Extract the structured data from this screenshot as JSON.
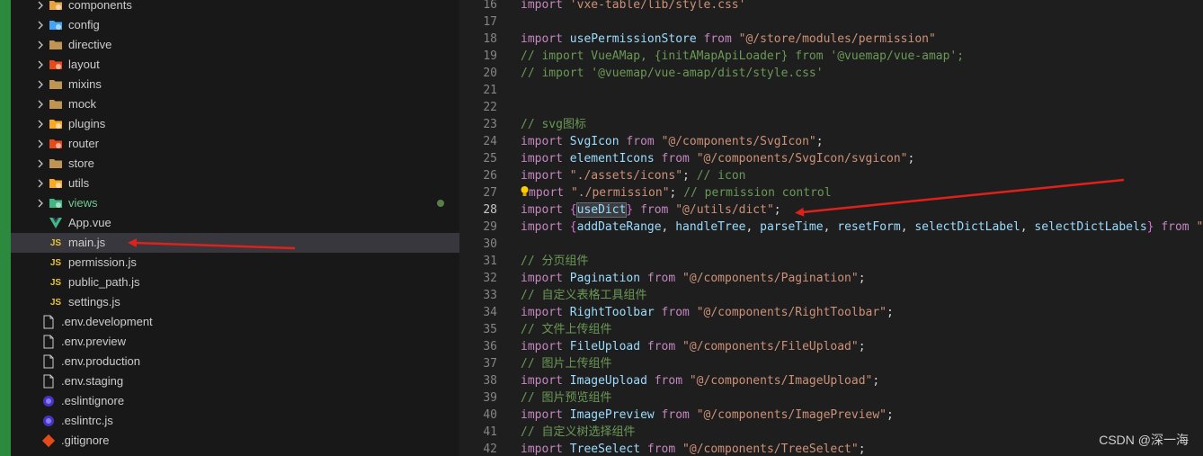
{
  "explorer": {
    "items": [
      {
        "label": "components",
        "kind": "folder",
        "icon": "components-folder-icon",
        "level": 1,
        "expandable": true,
        "color": "#e8a33d"
      },
      {
        "label": "config",
        "kind": "folder",
        "icon": "config-folder-icon",
        "level": 1,
        "expandable": true,
        "color": "#42a5f5"
      },
      {
        "label": "directive",
        "kind": "folder",
        "icon": "folder-icon",
        "level": 1,
        "expandable": true,
        "color": "#c09553"
      },
      {
        "label": "layout",
        "kind": "folder",
        "icon": "layout-folder-icon",
        "level": 1,
        "expandable": true,
        "color": "#e64a19"
      },
      {
        "label": "mixins",
        "kind": "folder",
        "icon": "folder-icon",
        "level": 1,
        "expandable": true,
        "color": "#c09553"
      },
      {
        "label": "mock",
        "kind": "folder",
        "icon": "folder-icon",
        "level": 1,
        "expandable": true,
        "color": "#c09553"
      },
      {
        "label": "plugins",
        "kind": "folder",
        "icon": "plugins-folder-icon",
        "level": 1,
        "expandable": true,
        "color": "#f9a825"
      },
      {
        "label": "router",
        "kind": "folder",
        "icon": "router-folder-icon",
        "level": 1,
        "expandable": true,
        "color": "#e64a19"
      },
      {
        "label": "store",
        "kind": "folder",
        "icon": "folder-icon",
        "level": 1,
        "expandable": true,
        "color": "#c09553"
      },
      {
        "label": "utils",
        "kind": "folder",
        "icon": "utils-folder-icon",
        "level": 1,
        "expandable": true,
        "color": "#f9a825"
      },
      {
        "label": "views",
        "kind": "folder",
        "icon": "views-folder-icon",
        "level": 1,
        "expandable": true,
        "color": "#41b883",
        "modified": true
      },
      {
        "label": "App.vue",
        "kind": "file",
        "icon": "vue-file-icon",
        "level": 1,
        "expandable": false,
        "color": "#41b883"
      },
      {
        "label": "main.js",
        "kind": "file",
        "icon": "js-file-icon",
        "level": 1,
        "expandable": false,
        "color": "#e8c33a",
        "selected": true
      },
      {
        "label": "permission.js",
        "kind": "file",
        "icon": "js-file-icon",
        "level": 1,
        "expandable": false,
        "color": "#e8c33a"
      },
      {
        "label": "public_path.js",
        "kind": "file",
        "icon": "js-file-icon",
        "level": 1,
        "expandable": false,
        "color": "#e8c33a"
      },
      {
        "label": "settings.js",
        "kind": "file",
        "icon": "js-file-icon",
        "level": 1,
        "expandable": false,
        "color": "#e8c33a"
      },
      {
        "label": ".env.development",
        "kind": "file",
        "icon": "document-file-icon",
        "level": 0,
        "expandable": false,
        "color": "#cccccc"
      },
      {
        "label": ".env.preview",
        "kind": "file",
        "icon": "document-file-icon",
        "level": 0,
        "expandable": false,
        "color": "#cccccc"
      },
      {
        "label": ".env.production",
        "kind": "file",
        "icon": "document-file-icon",
        "level": 0,
        "expandable": false,
        "color": "#cccccc"
      },
      {
        "label": ".env.staging",
        "kind": "file",
        "icon": "document-file-icon",
        "level": 0,
        "expandable": false,
        "color": "#cccccc"
      },
      {
        "label": ".eslintignore",
        "kind": "file",
        "icon": "eslint-file-icon",
        "level": 0,
        "expandable": false,
        "color": "#7c6ff2"
      },
      {
        "label": ".eslintrc.js",
        "kind": "file",
        "icon": "eslint-file-icon",
        "level": 0,
        "expandable": false,
        "color": "#7c6ff2"
      },
      {
        "label": ".gitignore",
        "kind": "file",
        "icon": "git-file-icon",
        "level": 0,
        "expandable": false,
        "color": "#e64a19"
      }
    ],
    "js_badge": "JS"
  },
  "editor": {
    "current_line": 28,
    "lines": [
      {
        "n": "16",
        "tokens": [
          {
            "t": "import",
            "c": "kw"
          },
          {
            "t": " "
          },
          {
            "t": "'vxe-table/lib/style.css'",
            "c": "str"
          }
        ]
      },
      {
        "n": "17",
        "tokens": []
      },
      {
        "n": "18",
        "tokens": [
          {
            "t": "import",
            "c": "kw"
          },
          {
            "t": " "
          },
          {
            "t": "usePermissionStore",
            "c": "id"
          },
          {
            "t": " "
          },
          {
            "t": "from",
            "c": "kw"
          },
          {
            "t": " "
          },
          {
            "t": "\"@/store/modules/permission\"",
            "c": "str"
          }
        ]
      },
      {
        "n": "19",
        "tokens": [
          {
            "t": "// import VueAMap, {initAMapApiLoader} from '@vuemap/vue-amap';",
            "c": "com"
          }
        ]
      },
      {
        "n": "20",
        "tokens": [
          {
            "t": "// import '@vuemap/vue-amap/dist/style.css'",
            "c": "com"
          }
        ]
      },
      {
        "n": "21",
        "tokens": []
      },
      {
        "n": "22",
        "tokens": []
      },
      {
        "n": "23",
        "tokens": [
          {
            "t": "// svg图标",
            "c": "com"
          }
        ]
      },
      {
        "n": "24",
        "tokens": [
          {
            "t": "import",
            "c": "kw"
          },
          {
            "t": " "
          },
          {
            "t": "SvgIcon",
            "c": "id"
          },
          {
            "t": " "
          },
          {
            "t": "from",
            "c": "kw"
          },
          {
            "t": " "
          },
          {
            "t": "\"@/components/SvgIcon\"",
            "c": "str"
          },
          {
            "t": ";"
          }
        ]
      },
      {
        "n": "25",
        "tokens": [
          {
            "t": "import",
            "c": "kw"
          },
          {
            "t": " "
          },
          {
            "t": "elementIcons",
            "c": "id"
          },
          {
            "t": " "
          },
          {
            "t": "from",
            "c": "kw"
          },
          {
            "t": " "
          },
          {
            "t": "\"@/components/SvgIcon/svgicon\"",
            "c": "str"
          },
          {
            "t": ";"
          }
        ]
      },
      {
        "n": "26",
        "tokens": [
          {
            "t": "import",
            "c": "kw"
          },
          {
            "t": " "
          },
          {
            "t": "\"./assets/icons\"",
            "c": "str"
          },
          {
            "t": "; "
          },
          {
            "t": "// icon",
            "c": "com"
          }
        ]
      },
      {
        "n": "27",
        "bulb": true,
        "tokens": [
          {
            "t": "mport",
            "c": "kw"
          },
          {
            "t": " "
          },
          {
            "t": "\"./permission\"",
            "c": "str"
          },
          {
            "t": "; "
          },
          {
            "t": "// permission control",
            "c": "com"
          }
        ]
      },
      {
        "n": "28",
        "tokens": [
          {
            "t": "import",
            "c": "kw"
          },
          {
            "t": " "
          },
          {
            "t": "{",
            "c": "br2"
          },
          {
            "t": "useDict",
            "c": "id",
            "hl": true
          },
          {
            "t": "}",
            "c": "br2"
          },
          {
            "t": " "
          },
          {
            "t": "from",
            "c": "kw"
          },
          {
            "t": " "
          },
          {
            "t": "\"@/utils/dict\"",
            "c": "str"
          },
          {
            "t": ";"
          }
        ]
      },
      {
        "n": "29",
        "tokens": [
          {
            "t": "import",
            "c": "kw"
          },
          {
            "t": " "
          },
          {
            "t": "{",
            "c": "br2"
          },
          {
            "t": "addDateRange",
            "c": "id"
          },
          {
            "t": ", "
          },
          {
            "t": "handleTree",
            "c": "id"
          },
          {
            "t": ", "
          },
          {
            "t": "parseTime",
            "c": "id"
          },
          {
            "t": ", "
          },
          {
            "t": "resetForm",
            "c": "id"
          },
          {
            "t": ", "
          },
          {
            "t": "selectDictLabel",
            "c": "id"
          },
          {
            "t": ", "
          },
          {
            "t": "selectDictLabels",
            "c": "id"
          },
          {
            "t": "}",
            "c": "br2"
          },
          {
            "t": " "
          },
          {
            "t": "from",
            "c": "kw"
          },
          {
            "t": " "
          },
          {
            "t": "\"@/",
            "c": "str"
          }
        ]
      },
      {
        "n": "30",
        "tokens": []
      },
      {
        "n": "31",
        "tokens": [
          {
            "t": "// 分页组件",
            "c": "com"
          }
        ]
      },
      {
        "n": "32",
        "tokens": [
          {
            "t": "import",
            "c": "kw"
          },
          {
            "t": " "
          },
          {
            "t": "Pagination",
            "c": "id"
          },
          {
            "t": " "
          },
          {
            "t": "from",
            "c": "kw"
          },
          {
            "t": " "
          },
          {
            "t": "\"@/components/Pagination\"",
            "c": "str"
          },
          {
            "t": ";"
          }
        ]
      },
      {
        "n": "33",
        "tokens": [
          {
            "t": "// 自定义表格工具组件",
            "c": "com"
          }
        ]
      },
      {
        "n": "34",
        "tokens": [
          {
            "t": "import",
            "c": "kw"
          },
          {
            "t": " "
          },
          {
            "t": "RightToolbar",
            "c": "id"
          },
          {
            "t": " "
          },
          {
            "t": "from",
            "c": "kw"
          },
          {
            "t": " "
          },
          {
            "t": "\"@/components/RightToolbar\"",
            "c": "str"
          },
          {
            "t": ";"
          }
        ]
      },
      {
        "n": "35",
        "tokens": [
          {
            "t": "// 文件上传组件",
            "c": "com"
          }
        ]
      },
      {
        "n": "36",
        "tokens": [
          {
            "t": "import",
            "c": "kw"
          },
          {
            "t": " "
          },
          {
            "t": "FileUpload",
            "c": "id"
          },
          {
            "t": " "
          },
          {
            "t": "from",
            "c": "kw"
          },
          {
            "t": " "
          },
          {
            "t": "\"@/components/FileUpload\"",
            "c": "str"
          },
          {
            "t": ";"
          }
        ]
      },
      {
        "n": "37",
        "tokens": [
          {
            "t": "// 图片上传组件",
            "c": "com"
          }
        ]
      },
      {
        "n": "38",
        "tokens": [
          {
            "t": "import",
            "c": "kw"
          },
          {
            "t": " "
          },
          {
            "t": "ImageUpload",
            "c": "id"
          },
          {
            "t": " "
          },
          {
            "t": "from",
            "c": "kw"
          },
          {
            "t": " "
          },
          {
            "t": "\"@/components/ImageUpload\"",
            "c": "str"
          },
          {
            "t": ";"
          }
        ]
      },
      {
        "n": "39",
        "tokens": [
          {
            "t": "// 图片预览组件",
            "c": "com"
          }
        ]
      },
      {
        "n": "40",
        "tokens": [
          {
            "t": "import",
            "c": "kw"
          },
          {
            "t": " "
          },
          {
            "t": "ImagePreview",
            "c": "id"
          },
          {
            "t": " "
          },
          {
            "t": "from",
            "c": "kw"
          },
          {
            "t": " "
          },
          {
            "t": "\"@/components/ImagePreview\"",
            "c": "str"
          },
          {
            "t": ";"
          }
        ]
      },
      {
        "n": "41",
        "tokens": [
          {
            "t": "// 自定义树选择组件",
            "c": "com"
          }
        ]
      },
      {
        "n": "42",
        "tokens": [
          {
            "t": "import",
            "c": "kw"
          },
          {
            "t": " "
          },
          {
            "t": "TreeSelect",
            "c": "id"
          },
          {
            "t": " "
          },
          {
            "t": "from",
            "c": "kw"
          },
          {
            "t": " "
          },
          {
            "t": "\"@/components/TreeSelect\"",
            "c": "str"
          },
          {
            "t": ";"
          }
        ]
      }
    ]
  },
  "annotations": {
    "arrow_color": "#e0201a"
  },
  "watermark": "CSDN @深一海"
}
